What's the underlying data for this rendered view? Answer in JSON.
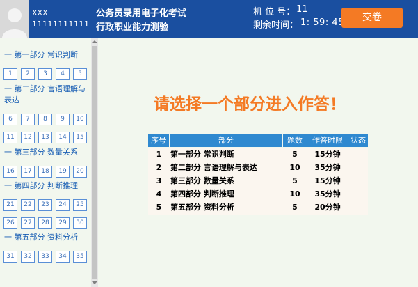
{
  "candidate": {
    "name": "XXX",
    "id": "11111111111"
  },
  "exam": {
    "title": "公务员录用电子化考试",
    "subject": "行政职业能力测验"
  },
  "seat": {
    "label": "机 位 号：",
    "value": "11"
  },
  "timer": {
    "label": "剩余时间：",
    "value": "1: 59: 45"
  },
  "submit_label": "交卷",
  "sidebar": {
    "sections": [
      {
        "title": "一  第一部分  常识判断",
        "questions": [
          "1",
          "2",
          "3",
          "4",
          "5"
        ]
      },
      {
        "title": "一  第二部分  言语理解与表达",
        "questions": [
          "6",
          "7",
          "8",
          "9",
          "10",
          "11",
          "12",
          "13",
          "14",
          "15"
        ]
      },
      {
        "title": "一  第三部分  数量关系",
        "questions": [
          "16",
          "17",
          "18",
          "19",
          "20"
        ]
      },
      {
        "title": "一  第四部分  判断推理",
        "questions": [
          "21",
          "22",
          "23",
          "24",
          "25",
          "26",
          "27",
          "28",
          "29",
          "30"
        ]
      },
      {
        "title": "一  第五部分  资料分析",
        "questions": [
          "31",
          "32",
          "33",
          "34",
          "35"
        ]
      }
    ]
  },
  "main": {
    "prompt": "请选择一个部分进入作答！",
    "table": {
      "headers": [
        "序号",
        "部分",
        "题数",
        "作答时限",
        "状态"
      ],
      "rows": [
        {
          "num": "1",
          "name": "第一部分  常识判断",
          "count": "5",
          "time": "15分钟",
          "status": ""
        },
        {
          "num": "2",
          "name": "第二部分  言语理解与表达",
          "count": "10",
          "time": "35分钟",
          "status": ""
        },
        {
          "num": "3",
          "name": "第三部分  数量关系",
          "count": "5",
          "time": "15分钟",
          "status": ""
        },
        {
          "num": "4",
          "name": "第四部分  判断推理",
          "count": "10",
          "time": "35分钟",
          "status": ""
        },
        {
          "num": "5",
          "name": "第五部分  资料分析",
          "count": "5",
          "time": "20分钟",
          "status": ""
        }
      ]
    }
  },
  "colors": {
    "header_bg": "#1a4fa0",
    "accent": "#f47a24",
    "table_header": "#2f89d0",
    "page_bg": "#f2f7ee"
  },
  "icons": {
    "avatar": "user-silhouette-icon",
    "scroll_up": "triangle-up-icon",
    "scroll_down": "triangle-down-icon"
  }
}
